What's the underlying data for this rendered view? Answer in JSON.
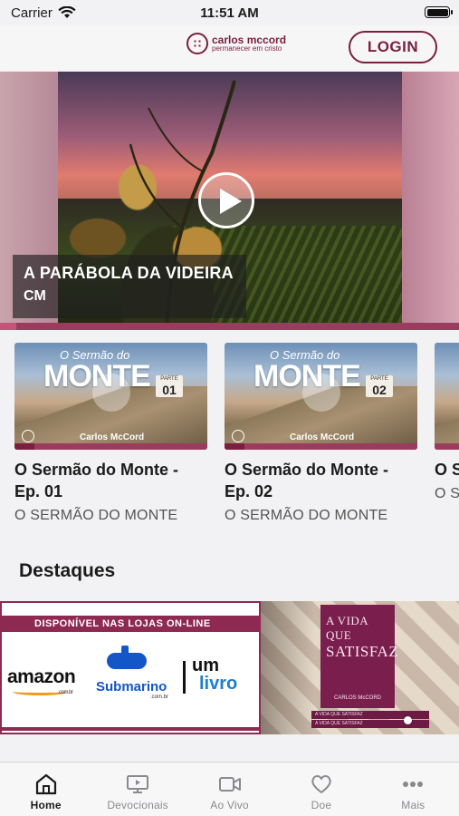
{
  "status_bar": {
    "carrier": "Carrier",
    "time": "11:51 AM"
  },
  "header": {
    "brand_name": "carlos mccord",
    "brand_tagline": "permanecer em cristo",
    "login_label": "LOGIN"
  },
  "hero": {
    "title": "A PARÁBOLA DA VIDEIRA",
    "subtitle": "CM"
  },
  "episodes": [
    {
      "title": "O Sermão do Monte - Ep. 01",
      "show": "O SERMÃO DO MONTE",
      "thumb": {
        "top_text": "O Sermão do",
        "main_text": "MONTE",
        "part_label": "PARTE",
        "part_number": "01",
        "author": "Carlos McCord"
      }
    },
    {
      "title": "O Sermão do Monte - Ep. 02",
      "show": "O SERMÃO DO MONTE",
      "thumb": {
        "top_text": "O Sermão do",
        "main_text": "MONTE",
        "part_label": "PARTE",
        "part_number": "02",
        "author": "Carlos McCord"
      }
    },
    {
      "title": "O S",
      "show": "O S"
    }
  ],
  "destaques": {
    "title": "Destaques",
    "banner_text": "DISPONÍVEL NAS LOJAS ON-LINE",
    "stores": {
      "amazon": "amazon",
      "amazon_domain": ".com.br",
      "submarino": "Submarino",
      "submarino_domain": ".com.br",
      "umlivro_um": "um",
      "umlivro_livro": "livro"
    },
    "book_title_1": "A VIDA QUE",
    "book_title_2": "SATISFAZ",
    "book_author": "CARLOS McCORD",
    "stack_spine": "A VIDA QUE SATISFAZ"
  },
  "tabs": [
    {
      "label": "Home",
      "icon": "home-icon",
      "active": true
    },
    {
      "label": "Devocionais",
      "icon": "monitor-icon",
      "active": false
    },
    {
      "label": "Ao Vivo",
      "icon": "video-camera-icon",
      "active": false
    },
    {
      "label": "Doe",
      "icon": "heart-icon",
      "active": false
    },
    {
      "label": "Mais",
      "icon": "more-dots-icon",
      "active": false
    }
  ],
  "colors": {
    "brand": "#7b1e3f",
    "banner": "#8e2a52",
    "progress": "#9b3c5e"
  }
}
